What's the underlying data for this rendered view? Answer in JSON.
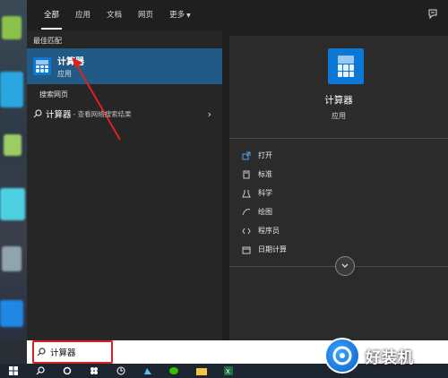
{
  "tabs": [
    {
      "label": "全部",
      "active": true
    },
    {
      "label": "应用",
      "active": false
    },
    {
      "label": "文档",
      "active": false
    },
    {
      "label": "网页",
      "active": false
    },
    {
      "label": "更多",
      "active": false
    }
  ],
  "left": {
    "best_match_label": "最佳匹配",
    "best_match": {
      "name": "计算器",
      "type": "应用",
      "icon": "calculator-icon"
    },
    "web_label": "搜索网页",
    "web_result": {
      "query": "计算器",
      "suffix": " - 查看网络搜索结果"
    }
  },
  "detail": {
    "title": "计算器",
    "subtitle": "应用",
    "actions": [
      {
        "label": "打开",
        "icon": "open-icon"
      },
      {
        "label": "标准",
        "icon": "standard-icon"
      },
      {
        "label": "科学",
        "icon": "science-icon"
      },
      {
        "label": "绘图",
        "icon": "graph-icon"
      },
      {
        "label": "程序员",
        "icon": "programmer-icon"
      },
      {
        "label": "日期计算",
        "icon": "calendar-icon"
      }
    ]
  },
  "search": {
    "value": "计算器"
  },
  "watermark": {
    "text": "好装机"
  },
  "colors": {
    "selected": "#215a85",
    "accent": "#0a78d4",
    "highlight": "#e02020"
  }
}
